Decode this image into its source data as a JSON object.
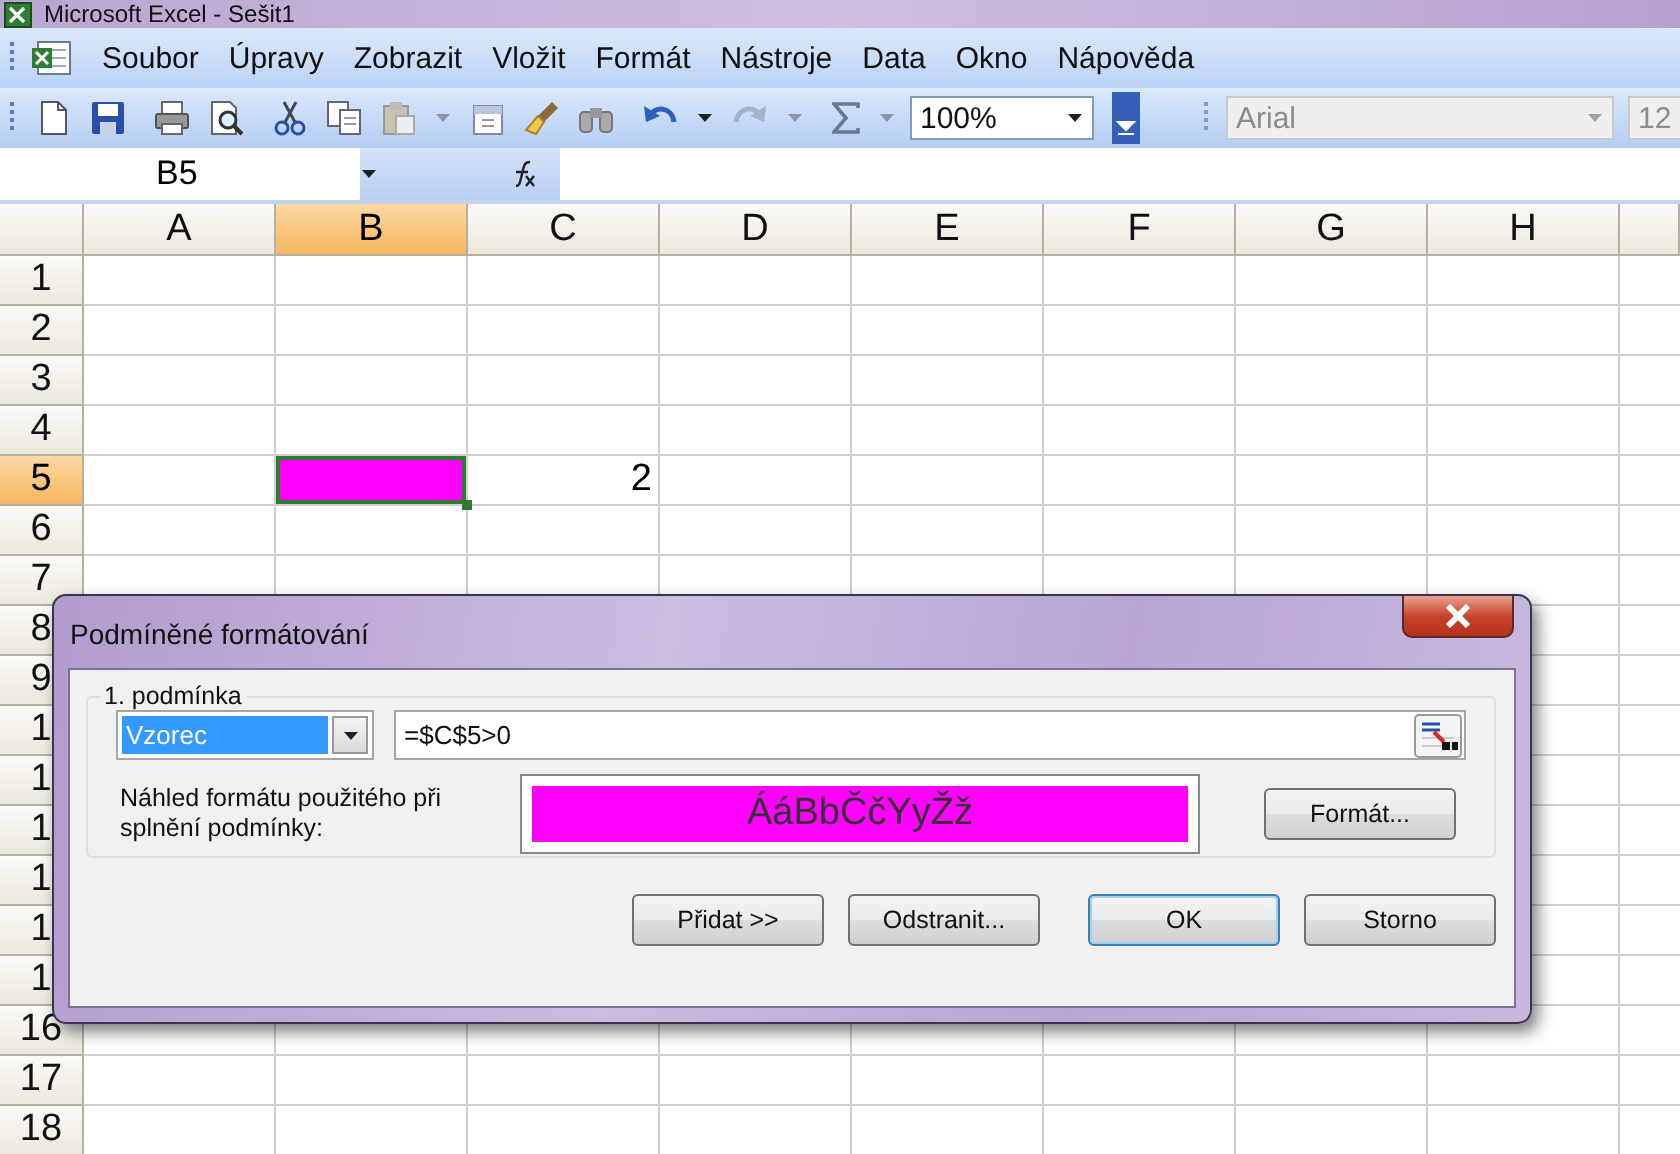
{
  "window": {
    "title": "Microsoft Excel - Sešit1"
  },
  "menu_bar": {
    "items": [
      "Soubor",
      "Úpravy",
      "Zobrazit",
      "Vložit",
      "Formát",
      "Nástroje",
      "Data",
      "Okno",
      "Nápověda"
    ]
  },
  "toolbar": {
    "zoom": "100%",
    "font": {
      "value": "Arial",
      "disabled": true
    },
    "font_size": {
      "value": "12",
      "disabled": true
    }
  },
  "formula_bar": {
    "name_box": "B5"
  },
  "sheet": {
    "columns": [
      {
        "label": "A",
        "selected": false
      },
      {
        "label": "B",
        "selected": true
      },
      {
        "label": "C",
        "selected": false
      },
      {
        "label": "D",
        "selected": false
      },
      {
        "label": "E",
        "selected": false
      },
      {
        "label": "F",
        "selected": false
      },
      {
        "label": "G",
        "selected": false
      },
      {
        "label": "H",
        "selected": false
      }
    ],
    "rows": [
      {
        "label": "1",
        "selected": false
      },
      {
        "label": "2",
        "selected": false
      },
      {
        "label": "3",
        "selected": false
      },
      {
        "label": "4",
        "selected": false
      },
      {
        "label": "5",
        "selected": true,
        "cells": [
          {
            "kind": "empty"
          },
          {
            "kind": "fill",
            "color": "#ff00ff",
            "selected": true
          },
          {
            "kind": "number",
            "value": "2"
          }
        ]
      },
      {
        "label": "6",
        "selected": false
      },
      {
        "label": "7",
        "selected": false
      },
      {
        "label": "8",
        "selected": false
      },
      {
        "label": "9",
        "selected": false
      },
      {
        "label": "1",
        "selected": false
      },
      {
        "label": "1",
        "selected": false
      },
      {
        "label": "1",
        "selected": false
      },
      {
        "label": "1",
        "selected": false
      },
      {
        "label": "1",
        "selected": false
      },
      {
        "label": "1",
        "selected": false
      },
      {
        "label": "16",
        "selected": false
      },
      {
        "label": "17",
        "selected": false
      },
      {
        "label": "18",
        "selected": false
      }
    ]
  },
  "dialog": {
    "title": "Podmíněné formátování",
    "condition": {
      "label": "1. podmínka",
      "type": "Vzorec",
      "formula": "=$C$5>0"
    },
    "preview": {
      "label": "Náhled formátu použitého při splnění podmínky:",
      "text": "ÁáBbČčYyŽž",
      "color": "#ff00ff"
    },
    "format_button": "Formát...",
    "buttons": [
      {
        "label": "Přidat >>",
        "default": false
      },
      {
        "label": "Odstranit...",
        "default": false
      },
      {
        "label": "OK",
        "default": true
      },
      {
        "label": "Storno",
        "default": false
      }
    ]
  }
}
